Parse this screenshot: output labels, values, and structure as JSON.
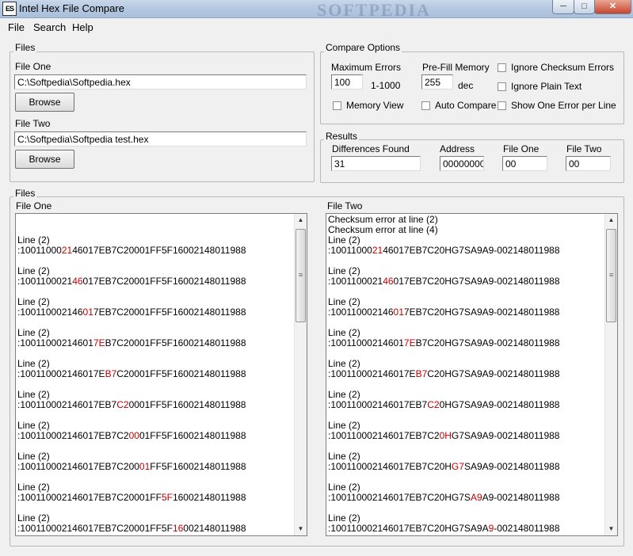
{
  "window": {
    "title": "Intel Hex File Compare",
    "app_icon_text": "ES",
    "watermark": "SOFTPEDIA",
    "controls": {
      "minimize": "─",
      "maximize": "□",
      "close": "✕"
    }
  },
  "menu": {
    "file": "File",
    "search": "Search",
    "help": "Help"
  },
  "files_group": {
    "legend": "Files",
    "file_one_label": "File One",
    "file_one_value": "C:\\Softpedia\\Softpedia.hex",
    "file_two_label": "File Two",
    "file_two_value": "C:\\Softpedia\\Softpedia test.hex",
    "browse_label": "Browse"
  },
  "compare_options": {
    "legend": "Compare Options",
    "max_errors_label": "Maximum Errors",
    "max_errors_value": "100",
    "max_errors_range": "1-1000",
    "prefill_label": "Pre-Fill Memory",
    "prefill_value": "255",
    "prefill_unit": "dec",
    "ignore_checksum": "Ignore Checksum Errors",
    "ignore_plain_text": "Ignore Plain Text",
    "memory_view": "Memory View",
    "auto_compare": "Auto Compare",
    "show_one_error": "Show One Error per Line"
  },
  "results": {
    "legend": "Results",
    "differences_label": "Differences Found",
    "differences_value": "31",
    "address_label": "Address",
    "address_value": "00000000",
    "file_one_label": "File One",
    "file_one_value": "00",
    "file_two_label": "File Two",
    "file_two_value": "00"
  },
  "files_panel": {
    "legend": "Files",
    "left_title": "File One",
    "right_title": "File Two",
    "left_header": [],
    "right_header": [
      "Checksum error at line (2)",
      "Checksum error at line (4)"
    ],
    "left_entries": [
      {
        "label": "Line (2)",
        "pre": ":10011000",
        "hi": "21",
        "post": "46017EB7C20001FF5F16002148011988"
      },
      {
        "label": "Line (2)",
        "pre": ":1001100021",
        "hi": "46",
        "post": "017EB7C20001FF5F16002148011988"
      },
      {
        "label": "Line (2)",
        "pre": ":100110002146",
        "hi": "01",
        "post": "7EB7C20001FF5F16002148011988"
      },
      {
        "label": "Line (2)",
        "pre": ":10011000214601",
        "hi": "7E",
        "post": "B7C20001FF5F16002148011988"
      },
      {
        "label": "Line (2)",
        "pre": ":100110002146017E",
        "hi": "B7",
        "post": "C20001FF5F16002148011988"
      },
      {
        "label": "Line (2)",
        "pre": ":100110002146017EB7",
        "hi": "C2",
        "post": "0001FF5F16002148011988"
      },
      {
        "label": "Line (2)",
        "pre": ":100110002146017EB7C2",
        "hi": "00",
        "post": "01FF5F16002148011988"
      },
      {
        "label": "Line (2)",
        "pre": ":100110002146017EB7C200",
        "hi": "01",
        "post": "FF5F16002148011988"
      },
      {
        "label": "Line (2)",
        "pre": ":100110002146017EB7C20001FF",
        "hi": "5F",
        "post": "16002148011988"
      },
      {
        "label": "Line (2)",
        "pre": ":100110002146017EB7C20001FF5F",
        "hi": "16",
        "post": "002148011988"
      }
    ],
    "right_entries": [
      {
        "label": "Line (2)",
        "pre": ":10011000",
        "hi": "21",
        "post": "46017EB7C20HG7SA9A9-002148011988"
      },
      {
        "label": "Line (2)",
        "pre": ":1001100021",
        "hi": "46",
        "post": "017EB7C20HG7SA9A9-002148011988"
      },
      {
        "label": "Line (2)",
        "pre": ":100110002146",
        "hi": "01",
        "post": "7EB7C20HG7SA9A9-002148011988"
      },
      {
        "label": "Line (2)",
        "pre": ":10011000214601",
        "hi": "7E",
        "post": "B7C20HG7SA9A9-002148011988"
      },
      {
        "label": "Line (2)",
        "pre": ":100110002146017E",
        "hi": "B7",
        "post": "C20HG7SA9A9-002148011988"
      },
      {
        "label": "Line (2)",
        "pre": ":100110002146017EB7",
        "hi": "C2",
        "post": "0HG7SA9A9-002148011988"
      },
      {
        "label": "Line (2)",
        "pre": ":100110002146017EB7C2",
        "hi": "0H",
        "post": "G7SA9A9-002148011988"
      },
      {
        "label": "Line (2)",
        "pre": ":100110002146017EB7C20H",
        "hi": "G7",
        "post": "SA9A9-002148011988"
      },
      {
        "label": "Line (2)",
        "pre": ":100110002146017EB7C20HG7S",
        "hi": "A9",
        "post": "A9-002148011988"
      },
      {
        "label": "Line (2)",
        "pre": ":100110002146017EB7C20HG7SA9A",
        "hi": "9",
        "post": "-002148011988"
      }
    ],
    "highlight_color": "#c00000",
    "scroll": {
      "up": "▲",
      "down": "▼",
      "grip": "≡"
    }
  }
}
